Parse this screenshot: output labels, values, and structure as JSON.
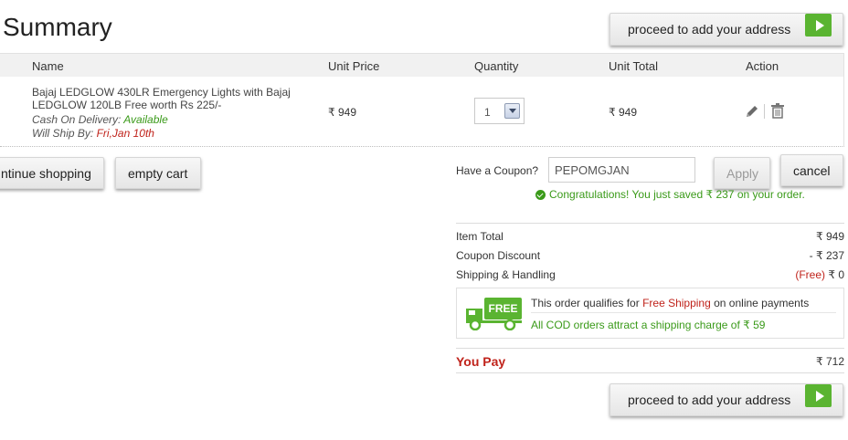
{
  "header": {
    "title": "Summary",
    "proceed_label": "proceed to add your address"
  },
  "table": {
    "columns": [
      "Name",
      "Unit Price",
      "Quantity",
      "Unit Total",
      "Action"
    ],
    "item": {
      "name": "Bajaj LEDGLOW 430LR Emergency Lights with Bajaj LEDGLOW 120LB Free worth Rs 225/-",
      "cod_label": "Cash On Delivery:",
      "cod_value": "Available",
      "ship_label": "Will Ship By:",
      "ship_value": "Fri,Jan 10th",
      "unit_price": "₹ 949",
      "quantity": "1",
      "unit_total": "₹ 949"
    },
    "actions": {
      "edit_icon": "pencil-icon",
      "delete_icon": "trash-icon"
    }
  },
  "buttons": {
    "continue": "ntinue shopping",
    "empty": "empty cart",
    "apply": "Apply",
    "cancel": "cancel"
  },
  "coupon": {
    "label": "Have a Coupon?",
    "value": "PEPOMGJAN",
    "message_pre": "Congratulations! You just saved",
    "message_amount": "₹ 237",
    "message_post": "on your order."
  },
  "totals": {
    "item_total_label": "Item Total",
    "item_total": "₹ 949",
    "discount_label": "Coupon Discount",
    "discount": "- ₹ 237",
    "shipping_label": "Shipping & Handling",
    "shipping_free": "(Free)",
    "shipping": "₹ 0"
  },
  "shipping_box": {
    "truck_label": "FREE",
    "line1_pre": "This order qualifies for",
    "line1_highlight": "Free Shipping",
    "line1_post": "on online payments",
    "line2": "All COD orders attract a shipping charge of ₹ 59"
  },
  "pay": {
    "label": "You Pay",
    "amount": "₹ 712"
  },
  "colors": {
    "accent_green": "#5ab431",
    "success": "#3a9a19",
    "alert_red": "#c0231b"
  }
}
